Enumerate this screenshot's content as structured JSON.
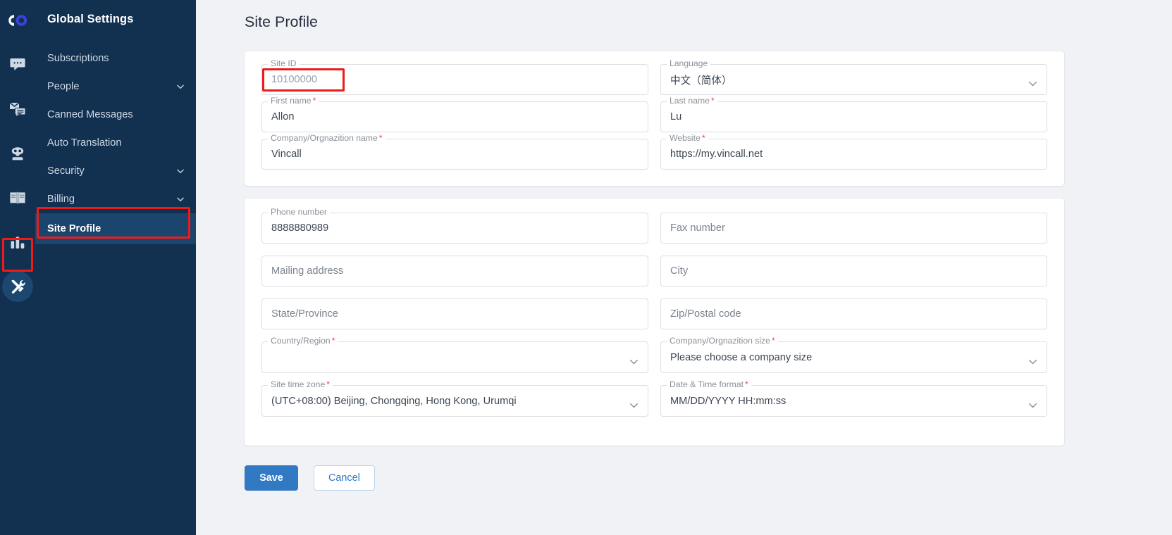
{
  "rail": {
    "logo_name": "company-logo",
    "items": [
      {
        "icon": "chat-bubble-icon",
        "name": "rail-item-chat"
      },
      {
        "icon": "email-chat-icon",
        "name": "rail-item-messages"
      },
      {
        "icon": "robot-icon",
        "name": "rail-item-bot"
      },
      {
        "icon": "book-icon",
        "name": "rail-item-knowledge-base"
      },
      {
        "icon": "bar-chart-icon",
        "name": "rail-item-reports"
      },
      {
        "icon": "tools-icon",
        "name": "rail-item-settings"
      }
    ]
  },
  "sidebar": {
    "title": "Global Settings",
    "items": [
      {
        "label": "Subscriptions",
        "expandable": false,
        "selected": false
      },
      {
        "label": "People",
        "expandable": true,
        "selected": false
      },
      {
        "label": "Canned Messages",
        "expandable": false,
        "selected": false
      },
      {
        "label": "Auto Translation",
        "expandable": false,
        "selected": false
      },
      {
        "label": "Security",
        "expandable": true,
        "selected": false
      },
      {
        "label": "Billing",
        "expandable": true,
        "selected": false
      },
      {
        "label": "Site Profile",
        "expandable": false,
        "selected": true
      }
    ]
  },
  "page": {
    "title": "Site Profile"
  },
  "card1": {
    "site_id": {
      "label": "Site ID",
      "value": "10100000",
      "required": false,
      "type": "text",
      "disabled": true
    },
    "language": {
      "label": "Language",
      "value": "中文（简体）",
      "required": false,
      "type": "select"
    },
    "first_name": {
      "label": "First name",
      "value": "Allon",
      "required": true,
      "type": "text"
    },
    "last_name": {
      "label": "Last name",
      "value": "Lu",
      "required": true,
      "type": "text"
    },
    "company_name": {
      "label": "Company/Orgnazition name",
      "value": "Vincall",
      "required": true,
      "type": "text"
    },
    "website": {
      "label": "Website",
      "value": "https://my.vincall.net",
      "required": true,
      "type": "text"
    }
  },
  "card2": {
    "phone_number": {
      "label": "Phone number",
      "value": "8888880989",
      "required": false,
      "type": "text"
    },
    "fax_number": {
      "label": "",
      "placeholder": "Fax number",
      "value": "",
      "required": false,
      "type": "text"
    },
    "mailing_address": {
      "label": "",
      "placeholder": "Mailing address",
      "value": "",
      "required": false,
      "type": "text"
    },
    "city": {
      "label": "",
      "placeholder": "City",
      "value": "",
      "required": false,
      "type": "text"
    },
    "state_province": {
      "label": "",
      "placeholder": "State/Province",
      "value": "",
      "required": false,
      "type": "text"
    },
    "zip_code": {
      "label": "",
      "placeholder": "Zip/Postal code",
      "value": "",
      "required": false,
      "type": "text"
    },
    "country_region": {
      "label": "Country/Region",
      "value": "",
      "required": true,
      "type": "select"
    },
    "company_size": {
      "label": "Company/Orgnazition size",
      "value": "Please choose a company size",
      "required": true,
      "type": "select"
    },
    "site_time_zone": {
      "label": "Site time zone",
      "value": "(UTC+08:00) Beijing, Chongqing, Hong Kong, Urumqi",
      "required": true,
      "type": "select"
    },
    "date_time_format": {
      "label": "Date & Time format",
      "value": "MM/DD/YYYY HH:mm:ss",
      "required": true,
      "type": "select"
    }
  },
  "actions": {
    "save_label": "Save",
    "cancel_label": "Cancel"
  },
  "colors": {
    "sidebar_bg": "#12304f",
    "sidebar_selected": "#1b456d",
    "page_bg": "#f1f2f6",
    "primary": "#3279c4",
    "highlight_box": "#ef1b1b",
    "required_star": "#e8445f"
  }
}
